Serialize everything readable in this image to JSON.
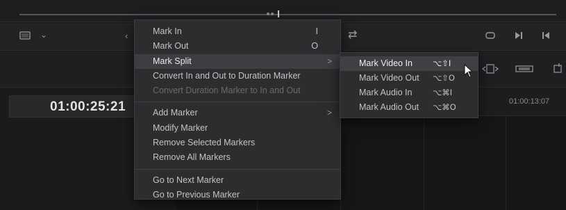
{
  "timecode": "01:00:25:21",
  "ruler_label": "01:00:13:07",
  "menu": {
    "items": [
      {
        "label": "Mark In",
        "shortcut": "I"
      },
      {
        "label": "Mark Out",
        "shortcut": "O"
      },
      {
        "label": "Mark Split",
        "arrow": ">"
      },
      {
        "label": "Convert In and Out to Duration Marker"
      },
      {
        "label": "Convert Duration Marker to In and Out"
      },
      {
        "label": "Add Marker",
        "arrow": ">"
      },
      {
        "label": "Modify Marker"
      },
      {
        "label": "Remove Selected Markers"
      },
      {
        "label": "Remove All Markers"
      },
      {
        "label": "Go to Next Marker"
      },
      {
        "label": "Go to Previous Marker"
      }
    ]
  },
  "submenu": {
    "items": [
      {
        "label": "Mark Video In",
        "shortcut": "⌥⇧I"
      },
      {
        "label": "Mark Video Out",
        "shortcut": "⌥⇧O"
      },
      {
        "label": "Mark Audio In",
        "shortcut": "⌥⌘I"
      },
      {
        "label": "Mark Audio Out",
        "shortcut": "⌥⌘O"
      }
    ]
  },
  "icons": {
    "viewer": "film-frame-icon",
    "dropdown": "chevron-down-icon",
    "prev": "chevron-left-icon",
    "loop": "loop-icon",
    "loop_range": "loop-range-icon",
    "play_end": "skip-end-icon",
    "to_start": "skip-start-icon",
    "trim": "trim-icon",
    "slip": "slip-icon",
    "overwrite": "overwrite-icon"
  }
}
